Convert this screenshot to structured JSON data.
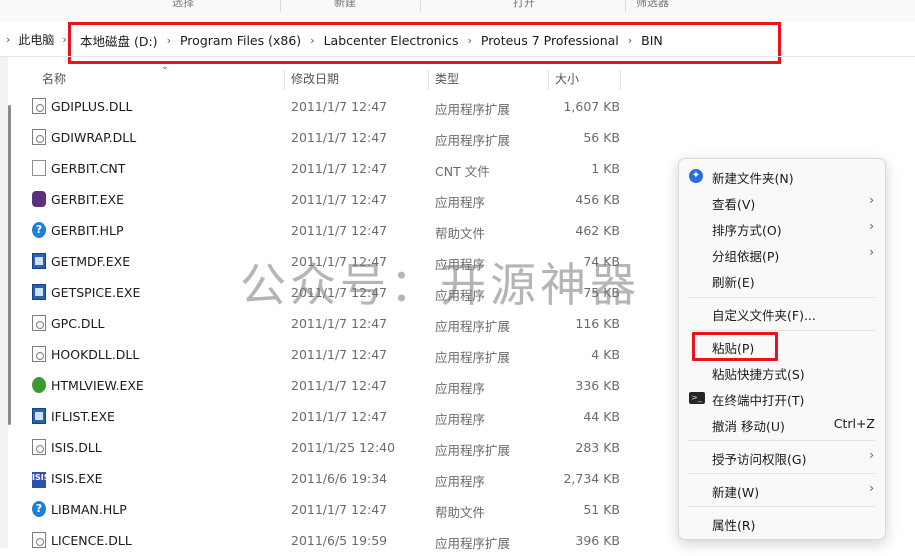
{
  "toolbar": {
    "items": [
      "选择",
      "新建",
      "打开",
      "筛选器"
    ]
  },
  "address": {
    "root": "此电脑",
    "crumbs": [
      "本地磁盘 (D:)",
      "Program Files (x86)",
      "Labcenter Electronics",
      "Proteus 7 Professional",
      "BIN"
    ]
  },
  "columns": {
    "name": "名称",
    "date": "修改日期",
    "type": "类型",
    "size": "大小"
  },
  "files": [
    {
      "name": "GDIPLUS.DLL",
      "date": "2011/1/7 12:47",
      "type": "应用程序扩展",
      "size": "1,607 KB",
      "icon": "dll-file-icon"
    },
    {
      "name": "GDIWRAP.DLL",
      "date": "2011/1/7 12:47",
      "type": "应用程序扩展",
      "size": "56 KB",
      "icon": "dll-file-icon"
    },
    {
      "name": "GERBIT.CNT",
      "date": "2011/1/7 12:47",
      "type": "CNT 文件",
      "size": "1 KB",
      "icon": "blank-file-icon"
    },
    {
      "name": "GERBIT.EXE",
      "date": "2011/1/7 12:47",
      "type": "应用程序",
      "size": "456 KB",
      "icon": "gerbit-app-icon"
    },
    {
      "name": "GERBIT.HLP",
      "date": "2011/1/7 12:47",
      "type": "帮助文件",
      "size": "462 KB",
      "icon": "help-file-icon"
    },
    {
      "name": "GETMDF.EXE",
      "date": "2011/1/7 12:47",
      "type": "应用程序",
      "size": "74 KB",
      "icon": "exe-window-icon"
    },
    {
      "name": "GETSPICE.EXE",
      "date": "2011/1/7 12:47",
      "type": "应用程序",
      "size": "75 KB",
      "icon": "exe-window-icon"
    },
    {
      "name": "GPC.DLL",
      "date": "2011/1/7 12:47",
      "type": "应用程序扩展",
      "size": "116 KB",
      "icon": "dll-file-icon"
    },
    {
      "name": "HOOKDLL.DLL",
      "date": "2011/1/7 12:47",
      "type": "应用程序扩展",
      "size": "4 KB",
      "icon": "dll-file-icon"
    },
    {
      "name": "HTMLVIEW.EXE",
      "date": "2011/1/7 12:47",
      "type": "应用程序",
      "size": "336 KB",
      "icon": "globe-app-icon"
    },
    {
      "name": "IFLIST.EXE",
      "date": "2011/1/7 12:47",
      "type": "应用程序",
      "size": "44 KB",
      "icon": "exe-window-icon"
    },
    {
      "name": "ISIS.DLL",
      "date": "2011/1/25 12:40",
      "type": "应用程序扩展",
      "size": "283 KB",
      "icon": "dll-file-icon"
    },
    {
      "name": "ISIS.EXE",
      "date": "2011/6/6 19:34",
      "type": "应用程序",
      "size": "2,734 KB",
      "icon": "isis-app-icon"
    },
    {
      "name": "LIBMAN.HLP",
      "date": "2011/1/7 12:47",
      "type": "帮助文件",
      "size": "51 KB",
      "icon": "help-file-icon"
    },
    {
      "name": "LICENCE.DLL",
      "date": "2011/6/5 19:59",
      "type": "应用程序扩展",
      "size": "396 KB",
      "icon": "dll-file-icon"
    }
  ],
  "watermark": "公众号：开源神器",
  "context_menu": {
    "items": [
      {
        "label": "新建文件夹(N)",
        "icon": "new-folder-icon"
      },
      {
        "label": "查看(V)",
        "submenu": true
      },
      {
        "label": "排序方式(O)",
        "submenu": true
      },
      {
        "label": "分组依据(P)",
        "submenu": true
      },
      {
        "label": "刷新(E)"
      },
      {
        "label": "自定义文件夹(F)..."
      },
      {
        "label": "粘贴(P)"
      },
      {
        "label": "粘贴快捷方式(S)"
      },
      {
        "label": "在终端中打开(T)",
        "icon": "terminal-icon"
      },
      {
        "label": "撤消 移动(U)",
        "shortcut": "Ctrl+Z"
      },
      {
        "label": "授予访问权限(G)",
        "submenu": true
      },
      {
        "label": "新建(W)",
        "submenu": true
      },
      {
        "label": "属性(R)"
      }
    ]
  },
  "colors": {
    "highlight_red": "#e8141b",
    "text": "#1a1a1a",
    "muted": "#6b6b6b"
  }
}
